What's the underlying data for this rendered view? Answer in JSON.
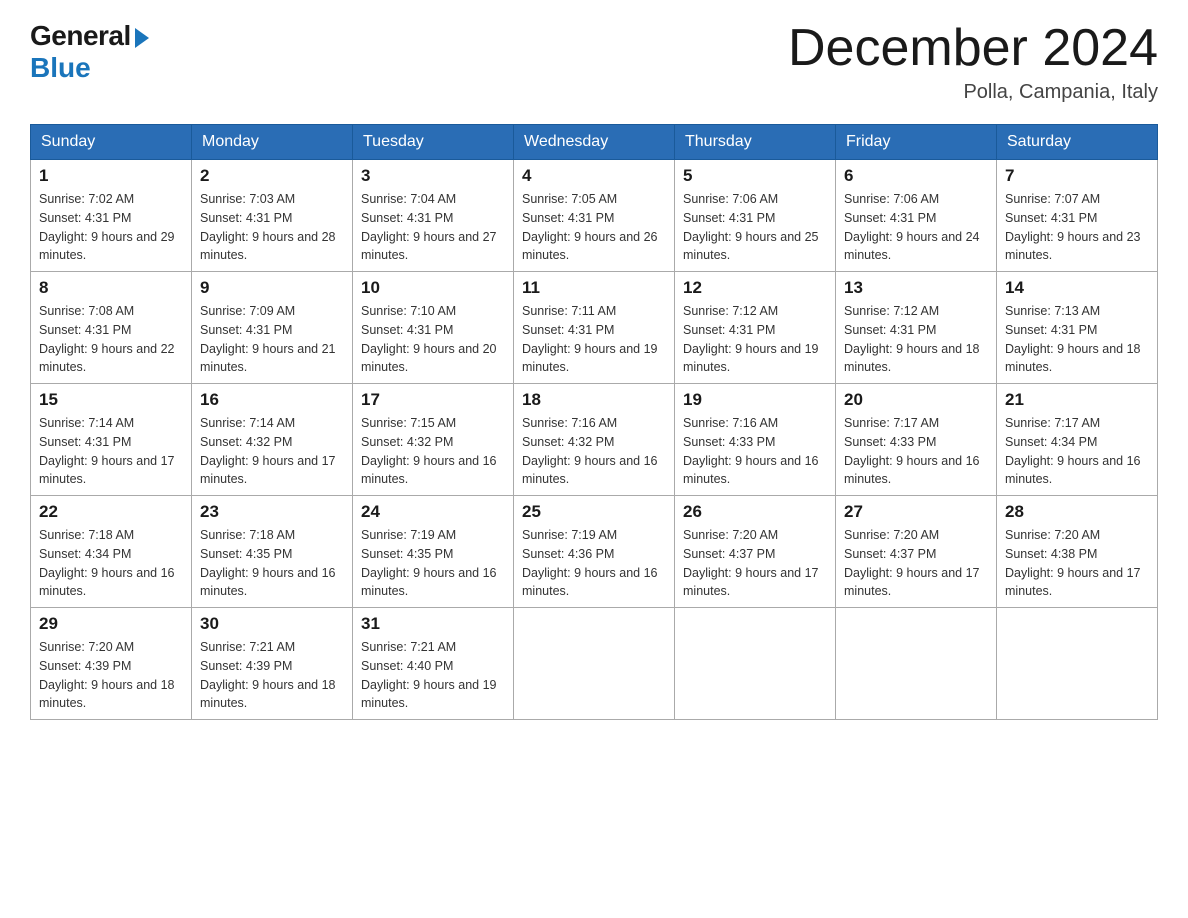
{
  "logo": {
    "general_text": "General",
    "blue_text": "Blue"
  },
  "header": {
    "month_year": "December 2024",
    "location": "Polla, Campania, Italy"
  },
  "days_of_week": [
    "Sunday",
    "Monday",
    "Tuesday",
    "Wednesday",
    "Thursday",
    "Friday",
    "Saturday"
  ],
  "weeks": [
    [
      {
        "day": "1",
        "sunrise": "7:02 AM",
        "sunset": "4:31 PM",
        "daylight": "9 hours and 29 minutes."
      },
      {
        "day": "2",
        "sunrise": "7:03 AM",
        "sunset": "4:31 PM",
        "daylight": "9 hours and 28 minutes."
      },
      {
        "day": "3",
        "sunrise": "7:04 AM",
        "sunset": "4:31 PM",
        "daylight": "9 hours and 27 minutes."
      },
      {
        "day": "4",
        "sunrise": "7:05 AM",
        "sunset": "4:31 PM",
        "daylight": "9 hours and 26 minutes."
      },
      {
        "day": "5",
        "sunrise": "7:06 AM",
        "sunset": "4:31 PM",
        "daylight": "9 hours and 25 minutes."
      },
      {
        "day": "6",
        "sunrise": "7:06 AM",
        "sunset": "4:31 PM",
        "daylight": "9 hours and 24 minutes."
      },
      {
        "day": "7",
        "sunrise": "7:07 AM",
        "sunset": "4:31 PM",
        "daylight": "9 hours and 23 minutes."
      }
    ],
    [
      {
        "day": "8",
        "sunrise": "7:08 AM",
        "sunset": "4:31 PM",
        "daylight": "9 hours and 22 minutes."
      },
      {
        "day": "9",
        "sunrise": "7:09 AM",
        "sunset": "4:31 PM",
        "daylight": "9 hours and 21 minutes."
      },
      {
        "day": "10",
        "sunrise": "7:10 AM",
        "sunset": "4:31 PM",
        "daylight": "9 hours and 20 minutes."
      },
      {
        "day": "11",
        "sunrise": "7:11 AM",
        "sunset": "4:31 PM",
        "daylight": "9 hours and 19 minutes."
      },
      {
        "day": "12",
        "sunrise": "7:12 AM",
        "sunset": "4:31 PM",
        "daylight": "9 hours and 19 minutes."
      },
      {
        "day": "13",
        "sunrise": "7:12 AM",
        "sunset": "4:31 PM",
        "daylight": "9 hours and 18 minutes."
      },
      {
        "day": "14",
        "sunrise": "7:13 AM",
        "sunset": "4:31 PM",
        "daylight": "9 hours and 18 minutes."
      }
    ],
    [
      {
        "day": "15",
        "sunrise": "7:14 AM",
        "sunset": "4:31 PM",
        "daylight": "9 hours and 17 minutes."
      },
      {
        "day": "16",
        "sunrise": "7:14 AM",
        "sunset": "4:32 PM",
        "daylight": "9 hours and 17 minutes."
      },
      {
        "day": "17",
        "sunrise": "7:15 AM",
        "sunset": "4:32 PM",
        "daylight": "9 hours and 16 minutes."
      },
      {
        "day": "18",
        "sunrise": "7:16 AM",
        "sunset": "4:32 PM",
        "daylight": "9 hours and 16 minutes."
      },
      {
        "day": "19",
        "sunrise": "7:16 AM",
        "sunset": "4:33 PM",
        "daylight": "9 hours and 16 minutes."
      },
      {
        "day": "20",
        "sunrise": "7:17 AM",
        "sunset": "4:33 PM",
        "daylight": "9 hours and 16 minutes."
      },
      {
        "day": "21",
        "sunrise": "7:17 AM",
        "sunset": "4:34 PM",
        "daylight": "9 hours and 16 minutes."
      }
    ],
    [
      {
        "day": "22",
        "sunrise": "7:18 AM",
        "sunset": "4:34 PM",
        "daylight": "9 hours and 16 minutes."
      },
      {
        "day": "23",
        "sunrise": "7:18 AM",
        "sunset": "4:35 PM",
        "daylight": "9 hours and 16 minutes."
      },
      {
        "day": "24",
        "sunrise": "7:19 AM",
        "sunset": "4:35 PM",
        "daylight": "9 hours and 16 minutes."
      },
      {
        "day": "25",
        "sunrise": "7:19 AM",
        "sunset": "4:36 PM",
        "daylight": "9 hours and 16 minutes."
      },
      {
        "day": "26",
        "sunrise": "7:20 AM",
        "sunset": "4:37 PM",
        "daylight": "9 hours and 17 minutes."
      },
      {
        "day": "27",
        "sunrise": "7:20 AM",
        "sunset": "4:37 PM",
        "daylight": "9 hours and 17 minutes."
      },
      {
        "day": "28",
        "sunrise": "7:20 AM",
        "sunset": "4:38 PM",
        "daylight": "9 hours and 17 minutes."
      }
    ],
    [
      {
        "day": "29",
        "sunrise": "7:20 AM",
        "sunset": "4:39 PM",
        "daylight": "9 hours and 18 minutes."
      },
      {
        "day": "30",
        "sunrise": "7:21 AM",
        "sunset": "4:39 PM",
        "daylight": "9 hours and 18 minutes."
      },
      {
        "day": "31",
        "sunrise": "7:21 AM",
        "sunset": "4:40 PM",
        "daylight": "9 hours and 19 minutes."
      },
      null,
      null,
      null,
      null
    ]
  ],
  "labels": {
    "sunrise_prefix": "Sunrise: ",
    "sunset_prefix": "Sunset: ",
    "daylight_prefix": "Daylight: "
  }
}
